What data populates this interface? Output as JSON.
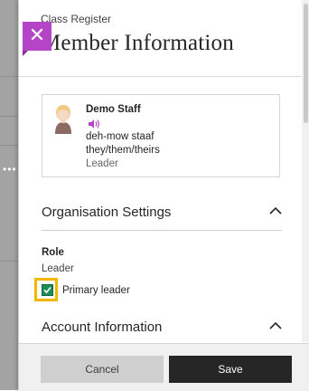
{
  "panel": {
    "breadcrumb": "Class Register",
    "title": "Member Information",
    "close_icon": "close-icon"
  },
  "profile": {
    "name": "Demo Staff",
    "pronunciation": "deh-mow staaf",
    "pronouns": "they/them/theirs",
    "role": "Leader",
    "speaker_icon": "speaker-icon",
    "accent_color": "#b545c7"
  },
  "organisation": {
    "heading": "Organisation Settings",
    "role_heading": "Role",
    "role_value": "Leader",
    "primary_leader_label": "Primary leader",
    "primary_leader_checked": true
  },
  "account": {
    "heading": "Account Information"
  },
  "footer": {
    "cancel_label": "Cancel",
    "save_label": "Save"
  },
  "colors": {
    "close_tab": "#b545c7",
    "checkbox": "#1d8c5b",
    "focus_ring": "#f2b600",
    "save_button": "#262626"
  }
}
